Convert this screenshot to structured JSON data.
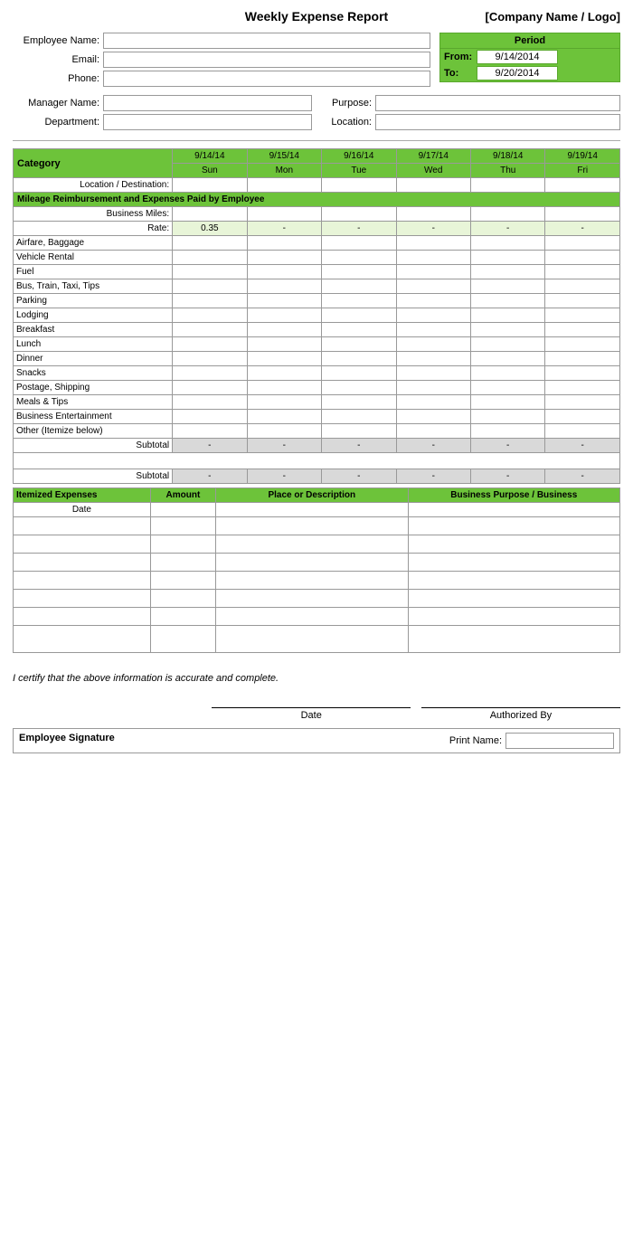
{
  "header": {
    "title": "Weekly Expense Report",
    "company": "[Company Name / Logo]"
  },
  "employee": {
    "name_label": "Employee Name:",
    "email_label": "Email:",
    "phone_label": "Phone:",
    "period_label": "Period",
    "from_label": "From:",
    "to_label": "To:",
    "from_value": "9/14/2014",
    "to_value": "9/20/2014"
  },
  "manager": {
    "manager_label": "Manager Name:",
    "department_label": "Department:",
    "purpose_label": "Purpose:",
    "location_label": "Location:"
  },
  "table": {
    "category_label": "Category",
    "location_dest_label": "Location / Destination:",
    "mileage_section": "Mileage Reimbursement and Expenses Paid by Employee",
    "business_miles_label": "Business Miles:",
    "rate_label": "Rate:",
    "rate_value": "0.35",
    "dates": [
      "9/14/14",
      "9/15/14",
      "9/16/14",
      "9/17/14",
      "9/18/14",
      "9/19/14"
    ],
    "days": [
      "Sun",
      "Mon",
      "Tue",
      "Wed",
      "Thu",
      "Fri"
    ],
    "dash": "-",
    "categories": [
      "Airfare, Baggage",
      "Vehicle Rental",
      "Fuel",
      "Bus, Train, Taxi, Tips",
      "Parking",
      "Lodging",
      "Breakfast",
      "Lunch",
      "Dinner",
      "Snacks",
      "Postage, Shipping",
      "Meals & Tips",
      "Business Entertainment",
      "Other (Itemize below)"
    ],
    "subtotal_label": "Subtotal",
    "subtotal2_label": "Subtotal"
  },
  "itemized": {
    "header": "Itemized Expenses",
    "col_amount": "Amount",
    "col_place": "Place or Description",
    "col_purpose": "Business Purpose / Business",
    "date_label": "Date",
    "rows": 7
  },
  "certify": {
    "text": "I certify that the above information is accurate and complete."
  },
  "signatures": {
    "date_label": "Date",
    "authorized_label": "Authorized By",
    "employee_sig_label": "Employee Signature",
    "print_name_label": "Print Name:"
  }
}
